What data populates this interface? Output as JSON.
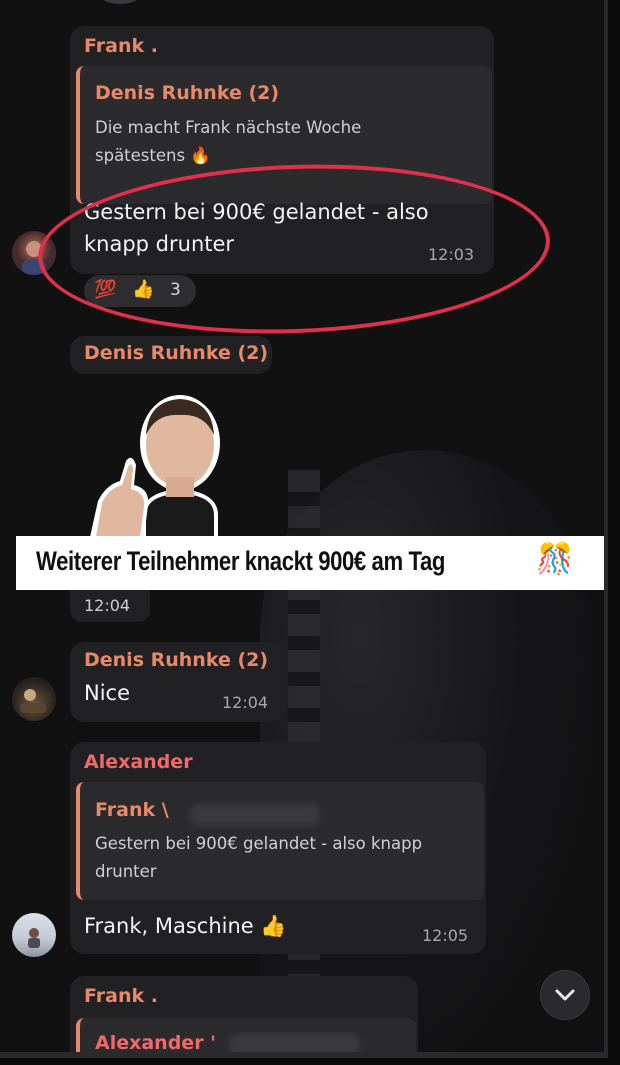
{
  "messages": {
    "m1": {
      "sender": "Frank .",
      "reply": {
        "sender": "Denis Ruhnke (2)",
        "text_line1": "Die macht Frank nächste Woche",
        "text_line2": "spätestens 🔥"
      },
      "text_line1": "Gestern bei 900€ gelandet - also",
      "text_line2": "knapp drunter",
      "time": "12:03",
      "reactions": {
        "emoji1": "💯",
        "emoji2": "👍",
        "count": "3"
      }
    },
    "m2": {
      "sender": "Denis Ruhnke (2)",
      "image_caption": "Weiterer Teilnehmer knackt 900€ am Tag",
      "image_emoji": "🎊",
      "time": "12:04"
    },
    "m3": {
      "sender": "Denis Ruhnke (2)",
      "text": "Nice",
      "time": "12:04"
    },
    "m4": {
      "sender": "Alexander",
      "reply": {
        "sender": "Frank \\",
        "text_line1": "Gestern bei 900€ gelandet - also knapp",
        "text_line2": "drunter"
      },
      "text": "Frank, Maschine 👍",
      "time": "12:05"
    },
    "m5": {
      "sender": "Frank .",
      "reply": {
        "sender": "Alexander '"
      }
    }
  },
  "colors": {
    "accent_orange": "#e8896a",
    "accent_pink": "#f06a6a",
    "annotation_red": "#e0304c",
    "bubble": "#212123"
  },
  "icons": {
    "scroll_down": "chevron-down-icon"
  }
}
